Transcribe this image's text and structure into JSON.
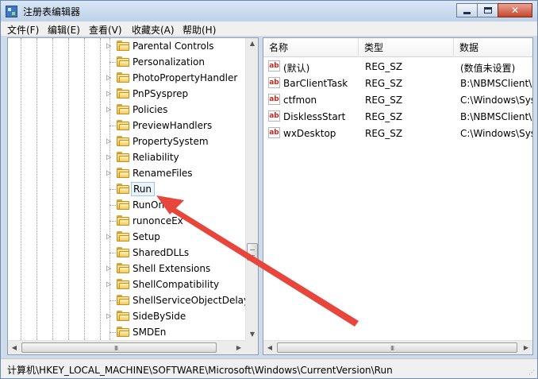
{
  "window": {
    "title": "注册表编辑器",
    "minimize_glyph": "",
    "maximize_glyph": "",
    "close_glyph": "✕"
  },
  "menu": [
    "文件(F)",
    "编辑(E)",
    "查看(V)",
    "收藏夹(A)",
    "帮助(H)"
  ],
  "tree": {
    "selected": "Run",
    "items": [
      {
        "label": "Parental Controls",
        "expandable": true
      },
      {
        "label": "Personalization",
        "expandable": false
      },
      {
        "label": "PhotoPropertyHandler",
        "expandable": true
      },
      {
        "label": "PnPSysprep",
        "expandable": true
      },
      {
        "label": "Policies",
        "expandable": true
      },
      {
        "label": "PreviewHandlers",
        "expandable": false
      },
      {
        "label": "PropertySystem",
        "expandable": true
      },
      {
        "label": "Reliability",
        "expandable": true
      },
      {
        "label": "RenameFiles",
        "expandable": true
      },
      {
        "label": "Run",
        "expandable": false
      },
      {
        "label": "RunOnce",
        "expandable": false
      },
      {
        "label": "runonceEx",
        "expandable": false
      },
      {
        "label": "Setup",
        "expandable": true
      },
      {
        "label": "SharedDLLs",
        "expandable": false
      },
      {
        "label": "Shell Extensions",
        "expandable": true
      },
      {
        "label": "ShellCompatibility",
        "expandable": true
      },
      {
        "label": "ShellServiceObjectDelayL",
        "expandable": false
      },
      {
        "label": "SideBySide",
        "expandable": true
      },
      {
        "label": "SMDEn",
        "expandable": false
      }
    ]
  },
  "list": {
    "columns": [
      "名称",
      "类型",
      "数据"
    ],
    "rows": [
      {
        "name": "(默认)",
        "type": "REG_SZ",
        "data": "(数值未设置)"
      },
      {
        "name": "BarClientTask",
        "type": "REG_SZ",
        "data": "B:\\NBMSClient\\"
      },
      {
        "name": "ctfmon",
        "type": "REG_SZ",
        "data": "C:\\Windows\\Sys"
      },
      {
        "name": "DisklessStart",
        "type": "REG_SZ",
        "data": "B:\\NBMSClient\\"
      },
      {
        "name": "wxDesktop",
        "type": "REG_SZ",
        "data": "C:\\Windows\\Sys"
      }
    ],
    "value_icon": "ab"
  },
  "scroll": {
    "up_glyph": "▲",
    "down_glyph": "▼",
    "left_glyph": "◀",
    "right_glyph": "▶",
    "grip_glyph": "III"
  },
  "status": {
    "path": "计算机\\HKEY_LOCAL_MACHINE\\SOFTWARE\\Microsoft\\Windows\\CurrentVersion\\Run"
  },
  "icons": {
    "folder": "folder-icon",
    "value": "string-value-icon",
    "app": "regedit-icon",
    "annotation": "red-arrow"
  },
  "colors": {
    "accent_arrow": "#e8453c",
    "selection_border": "#9cc8ef",
    "selection_fill": "#eaf4fd"
  }
}
